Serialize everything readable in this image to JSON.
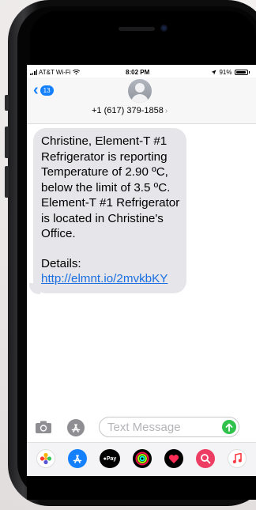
{
  "status_bar": {
    "carrier": "AT&T Wi-Fi",
    "time": "8:02 PM",
    "battery_text": "91%",
    "battery_level": 0.91
  },
  "header": {
    "back_badge": "13",
    "contact_number": "+1 (617) 379-1858"
  },
  "message": {
    "line1": "Christine, Element-T  #1 Refrigerator is reporting Temperature of 2.90 ºC, below the limit of 3.5 ºC. Element-T  #1 Refrigerator is located in Christine's Office.",
    "details_label": "Details: ",
    "details_link": "http://elmnt.io/2mvkbKY"
  },
  "input": {
    "placeholder": "Text Message"
  },
  "app_strip": {
    "pay_label": "Pay"
  },
  "colors": {
    "accent": "#1480fb",
    "bubble": "#e5e5ea",
    "send": "#31c24d"
  }
}
